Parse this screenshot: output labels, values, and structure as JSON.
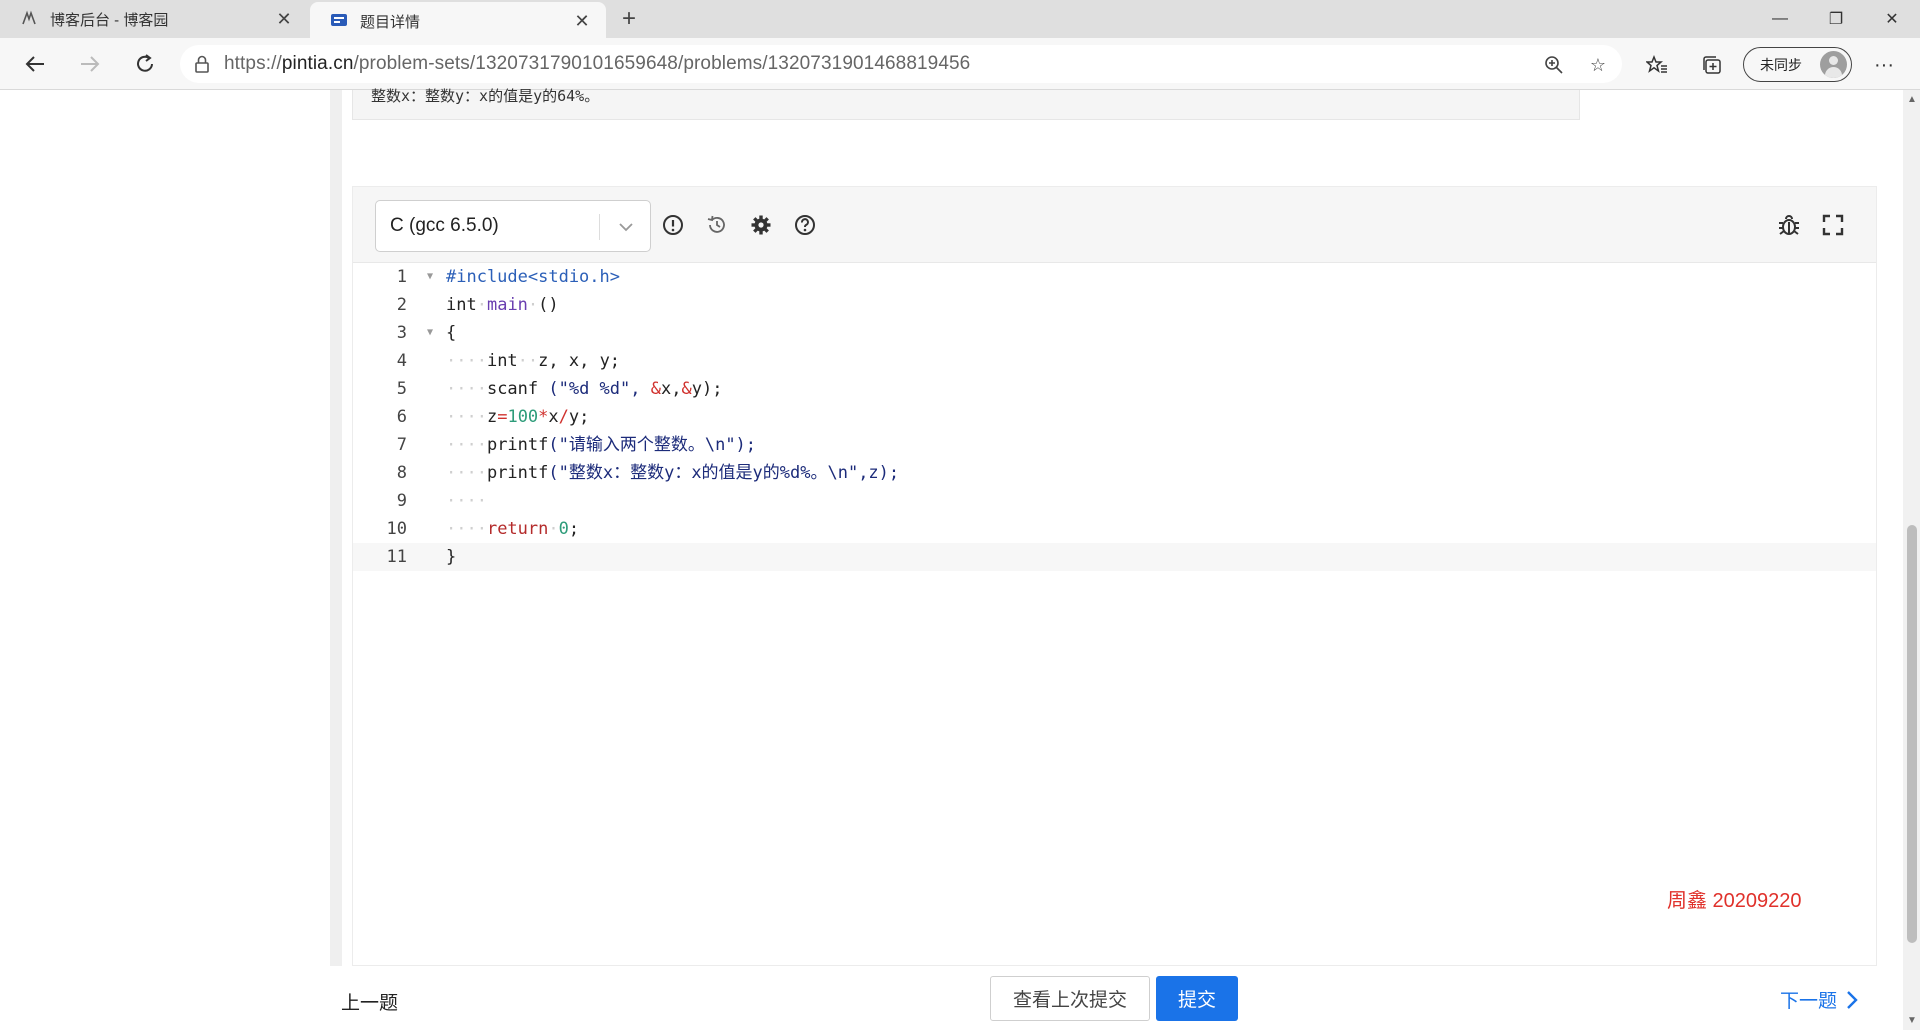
{
  "browser": {
    "tabs": [
      {
        "title": "博客后台 - 博客园",
        "active": false
      },
      {
        "title": "题目详情",
        "active": true
      }
    ],
    "url_prefix": "https://",
    "url_host": "pintia.cn",
    "url_path": "/problem-sets/1320731790101659648/problems/1320731901468819456",
    "sync_label": "未同步"
  },
  "sample_output": "整数x：整数y：x的值是y的64%。",
  "editor": {
    "language": "C (gcc 6.5.0)",
    "lines": [
      {
        "n": "1"
      },
      {
        "n": "2"
      },
      {
        "n": "3"
      },
      {
        "n": "4"
      },
      {
        "n": "5"
      },
      {
        "n": "6"
      },
      {
        "n": "7"
      },
      {
        "n": "8"
      },
      {
        "n": "9"
      },
      {
        "n": "10"
      },
      {
        "n": "11"
      }
    ],
    "code": {
      "l1": "#include<stdio.h>",
      "l2a": "int",
      "l2b": "main",
      "l2c": "()",
      "l3": "{",
      "l4a": "int",
      "l4b": "z, x, y;",
      "l5a": "scanf",
      "l5b": " (\"%d %d\", ",
      "l5c": "&",
      "l5d": "x,",
      "l5e": "&",
      "l5f": "y);",
      "l6a": "z",
      "l6b": "=",
      "l6c": "100",
      "l6d": "*",
      "l6e": "x",
      "l6f": "/",
      "l6g": "y;",
      "l7a": "printf",
      "l7b": "(\"请输入两个整数。\\n\");",
      "l8a": "printf",
      "l8b": "(\"整数x：整数y：x的值是y的%d%。\\n\",z);",
      "l10a": "return",
      "l10b": "0",
      "l11": "}"
    }
  },
  "watermark": "周鑫 20209220",
  "footer": {
    "prev": "上一题",
    "view_last": "查看上次提交",
    "submit": "提交",
    "next": "下一题"
  }
}
